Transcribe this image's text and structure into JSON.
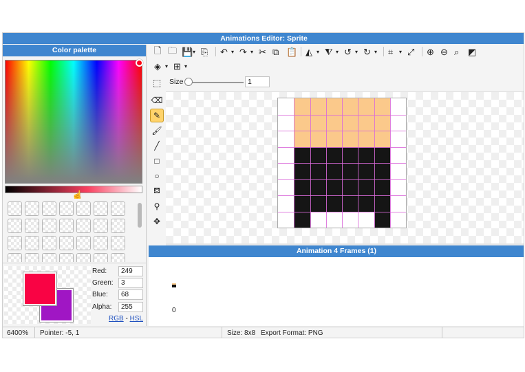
{
  "window": {
    "title": "Animations Editor: Sprite"
  },
  "palette": {
    "title": "Color palette",
    "red_label": "Red:",
    "red_value": "249",
    "green_label": "Green:",
    "green_value": "3",
    "blue_label": "Blue:",
    "blue_value": "68",
    "alpha_label": "Alpha:",
    "alpha_value": "255",
    "link_rgb": "RGB",
    "link_sep": " - ",
    "link_hsl": "HSL",
    "primary_color": "#f90344",
    "secondary_color": "#a016c4"
  },
  "toolbar": {
    "size_label": "Size",
    "size_value": "1",
    "row1_icons": [
      "new-file-icon",
      "open-folder-icon",
      "save-icon",
      "export-icon",
      "undo-icon",
      "redo-icon",
      "cut-icon",
      "copy-icon",
      "paste-icon",
      "flip-horizontal-icon",
      "flip-vertical-icon",
      "rotate-left-icon",
      "rotate-right-icon",
      "crop-icon",
      "resize-icon",
      "zoom-in-icon",
      "zoom-out-icon",
      "zoom-fit-icon",
      "background-toggle-icon"
    ],
    "row2_icons": [
      "layers-icon",
      "grid-icon"
    ]
  },
  "tools": [
    "eraser-icon",
    "pencil-icon",
    "brush-icon",
    "line-icon",
    "rectangle-icon",
    "ellipse-icon",
    "fill-bucket-icon",
    "eyedropper-icon",
    "move-icon"
  ],
  "sprite": {
    "width": 8,
    "height": 8,
    "colors": {
      "skin": "#fbc98b",
      "black": "#151515",
      "empty": "#ffffff"
    },
    "rows": [
      "_SSSSSS_",
      "_SSSSSS_",
      "_SSSSSS_",
      "_BBBBBB_",
      "_BBBBBB_",
      "_BBBBBB_",
      "_BBBBBB_",
      "_B____B_"
    ]
  },
  "animation": {
    "title": "Animation 4 Frames (1)",
    "frame_label": "0"
  },
  "status": {
    "zoom": "6400%",
    "pointer": "Pointer: -5, 1",
    "size": "Size: 8x8",
    "export": "Export Format: PNG"
  }
}
